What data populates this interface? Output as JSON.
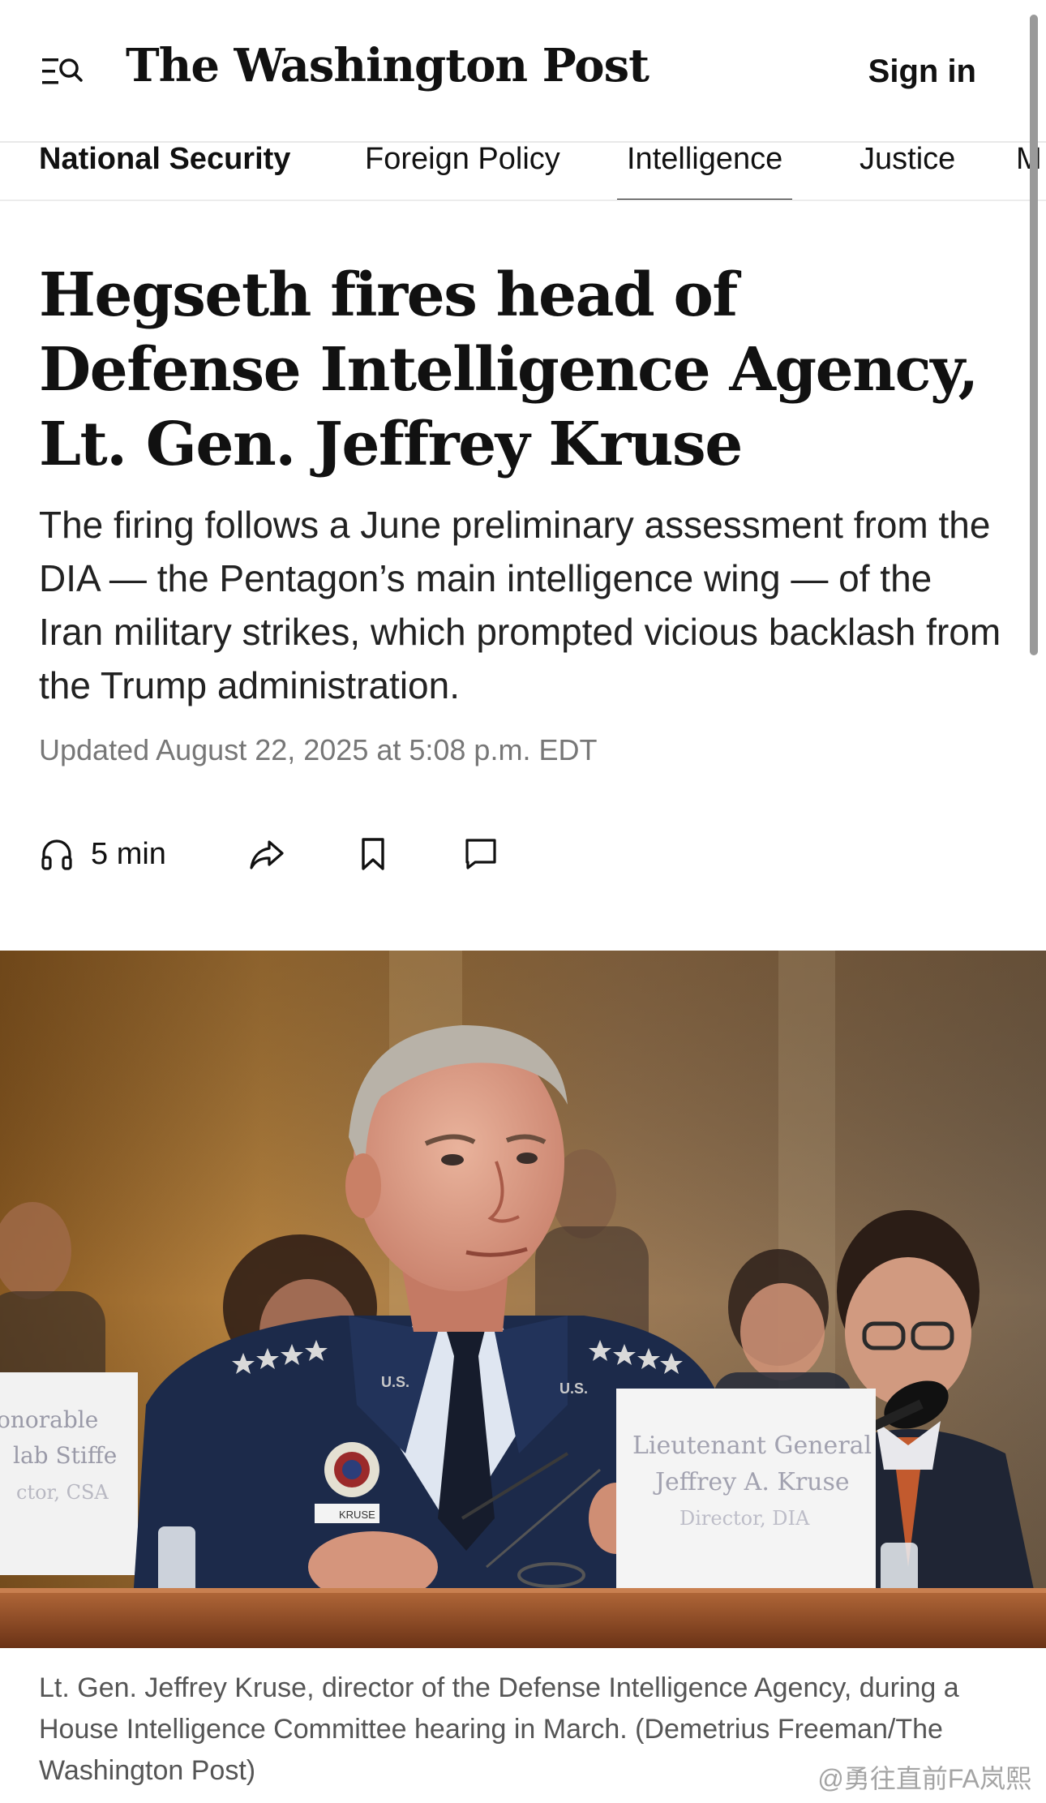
{
  "header": {
    "logo": "The Washington Post",
    "signin_label": "Sign in"
  },
  "nav": {
    "items": [
      {
        "label": "National Security",
        "bold": true,
        "active": false
      },
      {
        "label": "Foreign Policy",
        "bold": false,
        "active": false
      },
      {
        "label": "Intelligence",
        "bold": false,
        "active": true
      },
      {
        "label": "Justice",
        "bold": false,
        "active": false
      },
      {
        "label": "M",
        "bold": false,
        "active": false
      }
    ]
  },
  "article": {
    "headline": "Hegseth fires head of Defense Intelligence Agency, Lt. Gen. Jeffrey Kruse",
    "dek": "The firing follows a June preliminary assessment from the DIA — the Pentagon’s main intelligence wing — of the Iran military strikes, which prompted vicious backlash from the Trump administration.",
    "timestamp": "Updated August 22, 2025 at 5:08 p.m. EDT"
  },
  "actions": {
    "listen_label": "5 min",
    "icons": [
      "headphones-icon",
      "share-icon",
      "bookmark-icon",
      "comment-icon"
    ]
  },
  "photo": {
    "placard_right_lines": [
      "Lieutenant General",
      "Jeffrey A. Kruse",
      "Director, DIA"
    ],
    "placard_left_lines": [
      "onorable",
      "lab Stiffe",
      "ctor, CSA"
    ],
    "shoulder_letters": "U.S.",
    "name_tag": "KRUSE"
  },
  "caption": {
    "text": "Lt. Gen. Jeffrey Kruse, director of the Defense Intelligence Agency, during a House Intelligence Committee hearing in March. (Demetrius Freeman/The Washington Post)"
  },
  "watermark": "@勇往直前FA岚熙",
  "colors": {
    "text": "#111111",
    "muted": "#777777",
    "caption": "#555555",
    "uniform": "#1c2a4a"
  }
}
